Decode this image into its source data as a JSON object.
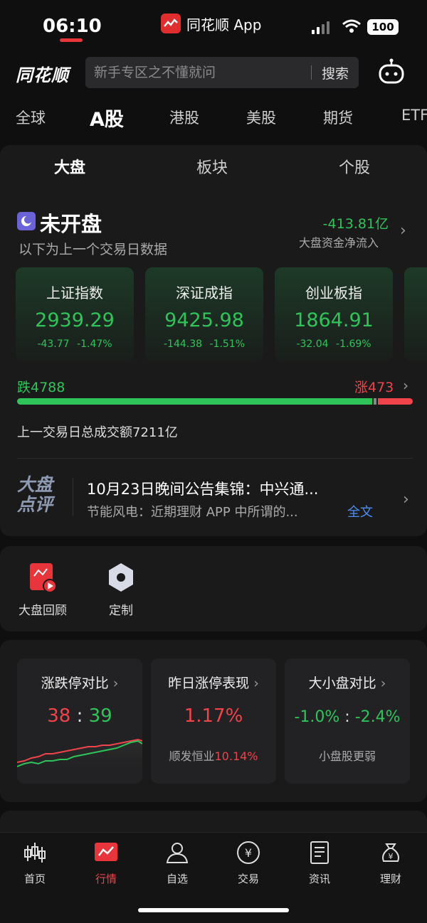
{
  "status_bar": {
    "time": "06:10",
    "app_name": "同花顺 App",
    "battery": "100"
  },
  "header": {
    "brand": "同花顺",
    "search_placeholder": "新手专区之不懂就问",
    "search_button": "搜索"
  },
  "market_tabs": [
    "全球",
    "A股",
    "港股",
    "美股",
    "期货",
    "ETF"
  ],
  "active_market_tab": "A股",
  "sub_tabs": [
    "大盘",
    "板块",
    "个股"
  ],
  "active_sub_tab": "大盘",
  "market_status": {
    "title": "未开盘",
    "note": "以下为上一个交易日数据",
    "net_flow_value": "-413.81亿",
    "net_flow_label": "大盘资金净流入"
  },
  "indices": [
    {
      "name": "上证指数",
      "price": "2939.29",
      "change": "-43.77",
      "pct": "-1.47%"
    },
    {
      "name": "深证成指",
      "price": "9425.98",
      "change": "-144.38",
      "pct": "-1.51%"
    },
    {
      "name": "创业板指",
      "price": "1864.91",
      "change": "-32.04",
      "pct": "-1.69%"
    }
  ],
  "breadth": {
    "fall_label": "跌4788",
    "rise_label": "涨473",
    "fall": 4788,
    "flat": 37,
    "rise": 473
  },
  "turnover": "上一交易日总成交额7211亿",
  "news": {
    "badge_line1": "大盘",
    "badge_line2": "点评",
    "title": "10月23日晚间公告集锦：中兴通...",
    "subtitle": "节能风电：近期理财 APP 中所谓的...",
    "link": "全文"
  },
  "tools": [
    {
      "label": "大盘回顾"
    },
    {
      "label": "定制"
    }
  ],
  "stats": [
    {
      "title": "涨跌停对比",
      "left": "38",
      "sep": ":",
      "right": "39"
    },
    {
      "title": "昨日涨停表现",
      "value": "1.17%",
      "sub_name": "顺发恒业",
      "sub_value": "10.14%"
    },
    {
      "title": "大小盘对比",
      "left": "-1.0%",
      "sep": ":",
      "right": "-2.4%",
      "sub": "小盘股更弱"
    }
  ],
  "nav": [
    {
      "label": "首页",
      "icon": "candlestick-icon"
    },
    {
      "label": "行情",
      "icon": "market-chart-icon"
    },
    {
      "label": "自选",
      "icon": "user-icon"
    },
    {
      "label": "交易",
      "icon": "yuan-icon"
    },
    {
      "label": "资讯",
      "icon": "document-icon"
    },
    {
      "label": "理财",
      "icon": "money-bag-icon"
    }
  ],
  "active_nav": "行情",
  "colors": {
    "up": "#f0434a",
    "down": "#2fc45a",
    "accent": "#e8353b",
    "link": "#4d8ef0"
  }
}
